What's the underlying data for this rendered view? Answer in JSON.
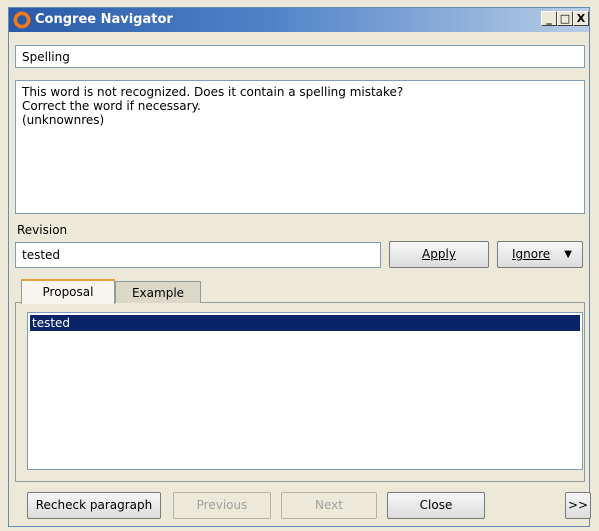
{
  "window": {
    "title": "Congree Navigator",
    "minimize": "_",
    "maximize": "□",
    "close": "X"
  },
  "category": "Spelling",
  "message": {
    "lines": [
      "This word is not recognized.  Does it contain a spelling mistake?",
      "Correct the word if necessary.",
      "(unknownres)"
    ]
  },
  "revision": {
    "label": "Revision",
    "value": "tested"
  },
  "buttons": {
    "apply": "Apply",
    "ignore": "Ignore",
    "ignore_arrow": "▼",
    "recheck": "Recheck paragraph",
    "previous": "Previous",
    "next": "Next",
    "close": "Close",
    "more": ">>"
  },
  "tabs": [
    {
      "label": "Proposal",
      "selected": true
    },
    {
      "label": "Example",
      "selected": false
    }
  ],
  "proposals": [
    "tested"
  ],
  "icons": {
    "app": "congree-logo-icon"
  }
}
